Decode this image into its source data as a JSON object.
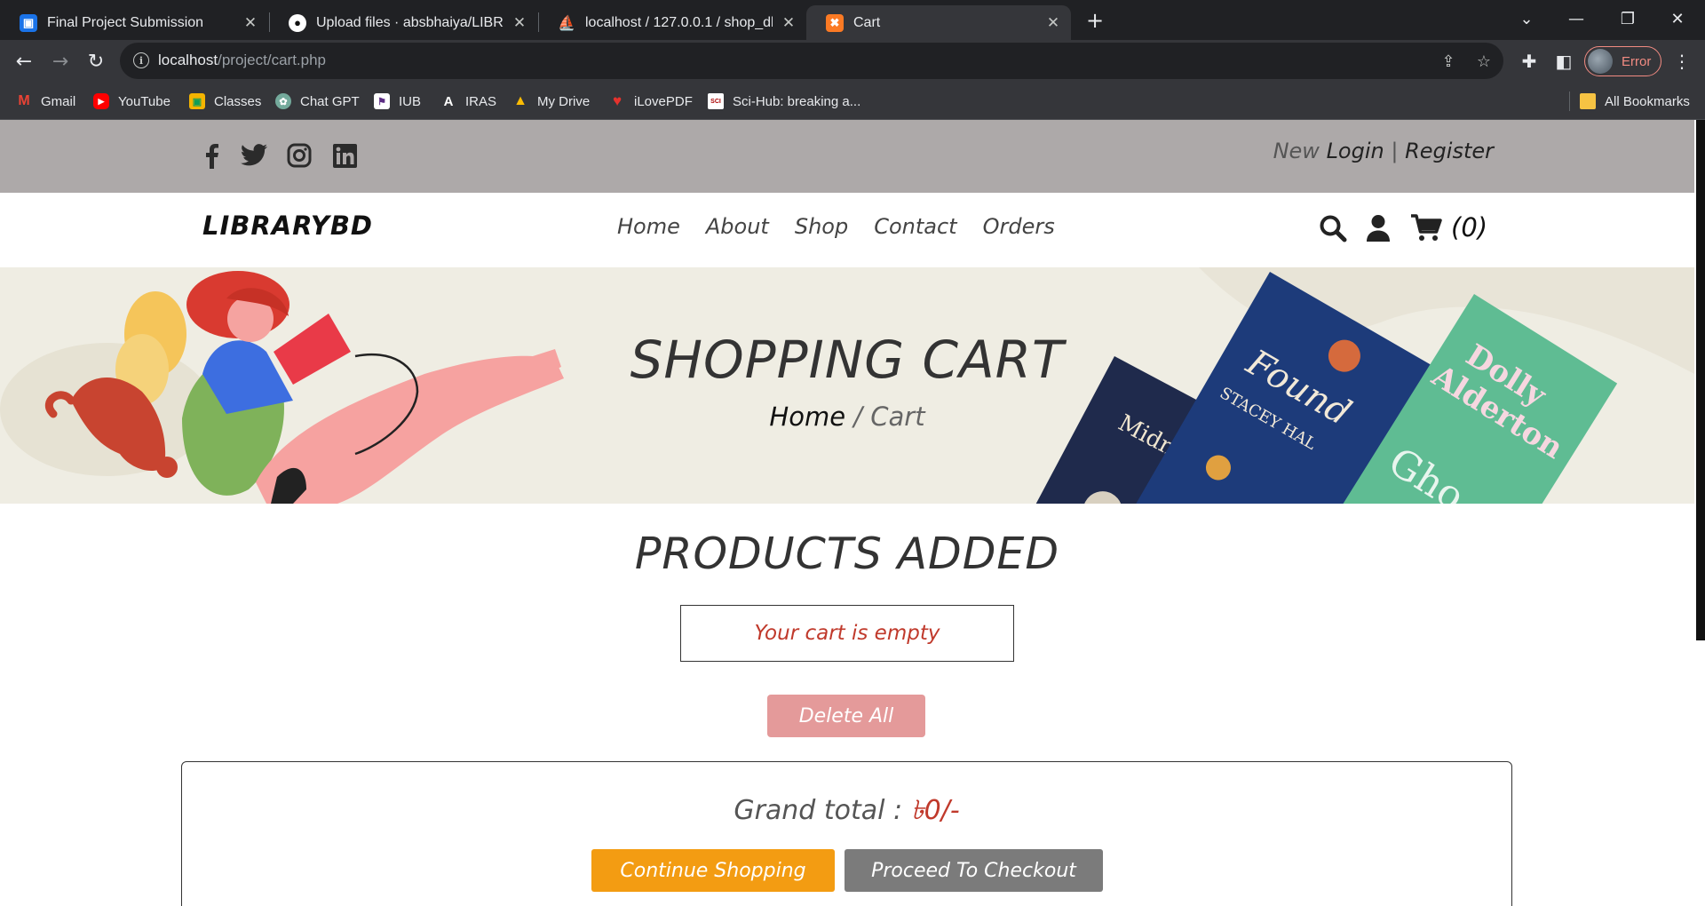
{
  "browser": {
    "tabs": [
      {
        "title": "Final Project Submission",
        "icon": "classroom-icon"
      },
      {
        "title": "Upload files · absbhaiya/LIBRAR",
        "icon": "github-icon"
      },
      {
        "title": "localhost / 127.0.0.1 / shop_db /",
        "icon": "phpmyadmin-icon"
      },
      {
        "title": "Cart",
        "icon": "xampp-icon",
        "active": true
      }
    ],
    "url_host": "localhost",
    "url_path": "/project/cart.php",
    "profile_status": "Error",
    "bookmarks": [
      {
        "label": "Gmail",
        "icon": "gmail-icon"
      },
      {
        "label": "YouTube",
        "icon": "youtube-icon"
      },
      {
        "label": "Classes",
        "icon": "classroom-icon"
      },
      {
        "label": "Chat GPT",
        "icon": "chatgpt-icon"
      },
      {
        "label": "IUB",
        "icon": "iub-icon"
      },
      {
        "label": "IRAS",
        "icon": "iras-icon"
      },
      {
        "label": "My Drive",
        "icon": "drive-icon"
      },
      {
        "label": "iLovePDF",
        "icon": "ilovepdf-icon"
      },
      {
        "label": "Sci-Hub: breaking a...",
        "icon": "scihub-icon"
      }
    ],
    "all_bookmarks": "All Bookmarks"
  },
  "site": {
    "header": {
      "social_icons": [
        "facebook-icon",
        "twitter-icon",
        "instagram-icon",
        "linkedin-icon"
      ],
      "auth_new": "New",
      "auth_login": "Login",
      "auth_separator": "|",
      "auth_register": "Register"
    },
    "logo": "LIBRARYBD",
    "nav": [
      "Home",
      "About",
      "Shop",
      "Contact",
      "Orders"
    ],
    "cart_count": "(0)",
    "hero": {
      "title": "SHOPPING CART",
      "crumb_home": "Home",
      "crumb_separator": "/",
      "crumb_current": "Cart"
    },
    "products": {
      "heading": "PRODUCTS ADDED",
      "empty_message": "Your cart is empty",
      "delete_all": "Delete All"
    },
    "totals": {
      "grand_label": "Grand total :",
      "grand_amount": "৳0/-",
      "continue": "Continue Shopping",
      "checkout": "Proceed To Checkout"
    }
  },
  "colors": {
    "top_strip": "#ada9a9",
    "hero_bg": "#efede3",
    "empty_text": "#c0392b",
    "delete_bg": "#e49a9a",
    "continue_bg": "#f39c12",
    "checkout_bg": "#7b7b7b"
  }
}
